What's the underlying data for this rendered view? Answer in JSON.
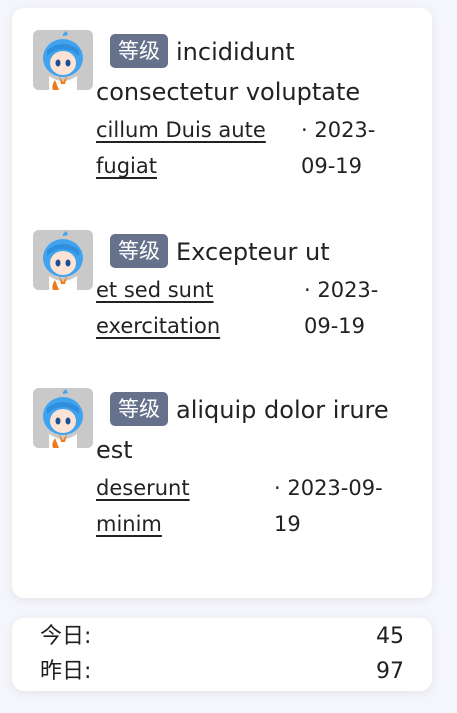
{
  "posts": [
    {
      "badge": "等级",
      "title": "incididunt consectetur voluptate",
      "author": "cillum Duis aute fugiat",
      "date": "· 2023-09-19"
    },
    {
      "badge": "等级",
      "title": "Excepteur ut",
      "author": "et sed sunt exercitation",
      "date": "· 2023-09-19"
    },
    {
      "badge": "等级",
      "title": "aliquip dolor irure est",
      "author": "deserunt minim",
      "date": "· 2023-09-19"
    }
  ],
  "stats": {
    "today_label": "今日:",
    "today_value": "45",
    "yesterday_label": "昨日:",
    "yesterday_value": "97"
  },
  "colors": {
    "badge_bg": "#66718c",
    "avatar_hair": "#3fa3f0",
    "avatar_bg": "#c9c9c9"
  },
  "icons": {
    "avatar": "anime-avatar-icon"
  }
}
